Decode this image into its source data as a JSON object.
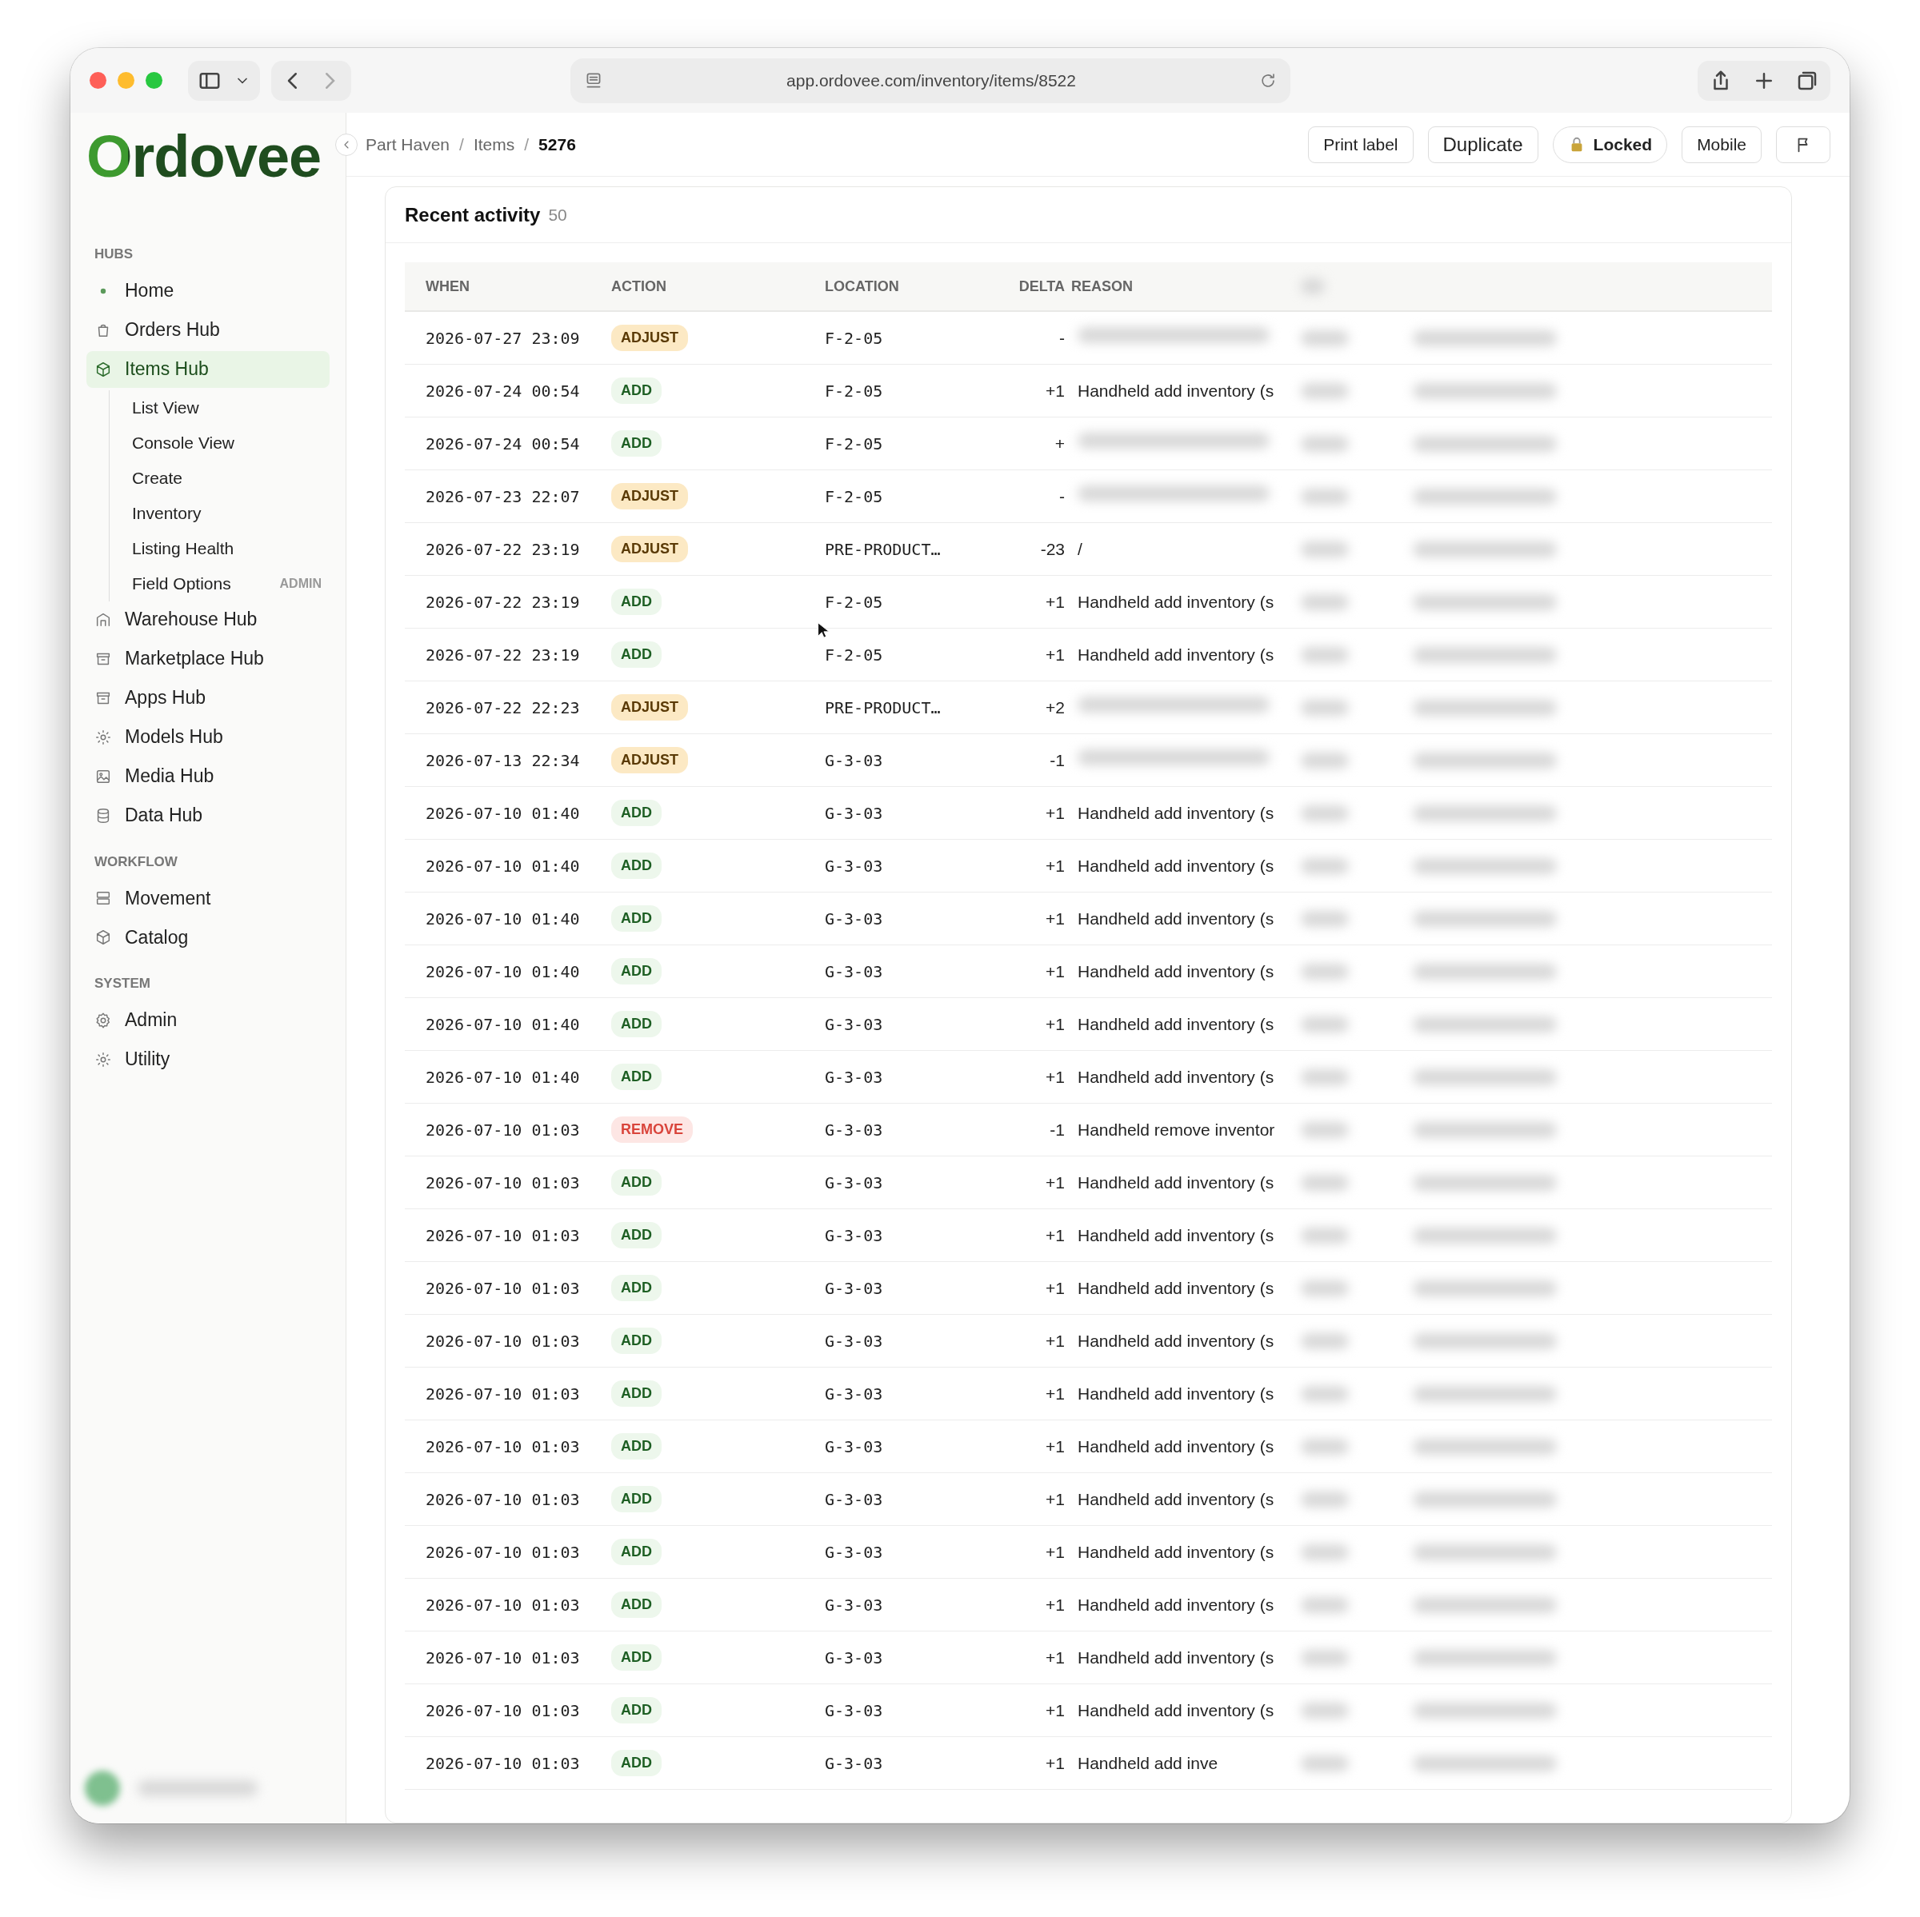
{
  "browser": {
    "url": "app.ordovee.com/inventory/items/8522"
  },
  "sidebar": {
    "logo": "Ordovee",
    "sections": [
      {
        "title": "HUBS",
        "items": [
          {
            "label": "Home",
            "selected": false
          },
          {
            "label": "Orders Hub",
            "selected": false
          },
          {
            "label": "Items Hub",
            "selected": true,
            "children": [
              {
                "label": "List View"
              },
              {
                "label": "Console View"
              },
              {
                "label": "Create"
              },
              {
                "label": "Inventory"
              },
              {
                "label": "Listing Health"
              },
              {
                "label": "Field Options",
                "tag": "ADMIN"
              }
            ]
          },
          {
            "label": "Warehouse Hub",
            "selected": false
          },
          {
            "label": "Marketplace Hub",
            "selected": false
          },
          {
            "label": "Apps Hub",
            "selected": false
          },
          {
            "label": "Models Hub",
            "selected": false
          },
          {
            "label": "Media Hub",
            "selected": false
          },
          {
            "label": "Data Hub",
            "selected": false
          }
        ]
      },
      {
        "title": "WORKFLOW",
        "items": [
          {
            "label": "Movement",
            "selected": false
          },
          {
            "label": "Catalog",
            "selected": false
          }
        ]
      },
      {
        "title": "SYSTEM",
        "items": [
          {
            "label": "Admin",
            "selected": false
          },
          {
            "label": "Utility",
            "selected": false
          }
        ]
      }
    ]
  },
  "breadcrumbs": [
    {
      "label": "Part Haven",
      "current": false
    },
    {
      "separator": "/",
      "label": "Items",
      "current": false
    },
    {
      "separator": "/",
      "label": "5276",
      "current": true
    }
  ],
  "actions": [
    {
      "kind": "text",
      "label": "Print label"
    },
    {
      "kind": "large",
      "label": "Duplicate"
    },
    {
      "kind": "lock",
      "label": "Locked"
    },
    {
      "kind": "text",
      "label": "Mobile"
    },
    {
      "kind": "flag"
    }
  ],
  "activity": {
    "title": "Recent activity",
    "count": "50",
    "columns": [
      "WHEN",
      "ACTION",
      "LOCATION",
      "DELTA",
      "REASON"
    ],
    "rows": [
      {
        "when": "2026-07-27 23:09",
        "action": "ADJUST",
        "kind": "adjust",
        "location": "F-2-05",
        "delta": "-"
      },
      {
        "when": "2026-07-24 00:54",
        "action": "ADD",
        "kind": "add",
        "location": "F-2-05",
        "delta": "+1",
        "reason": "Handheld add inventory (s"
      },
      {
        "when": "2026-07-24 00:54",
        "action": "ADD",
        "kind": "add",
        "location": "F-2-05",
        "delta": "+"
      },
      {
        "when": "2026-07-23 22:07",
        "action": "ADJUST",
        "kind": "adjust",
        "location": "F-2-05",
        "delta": "-"
      },
      {
        "when": "2026-07-22 23:19",
        "action": "ADJUST",
        "kind": "adjust",
        "location": "PRE-PRODUCT…",
        "delta": "-23",
        "reason": "/"
      },
      {
        "when": "2026-07-22 23:19",
        "action": "ADD",
        "kind": "add",
        "location": "F-2-05",
        "delta": "+1",
        "reason": "Handheld add inventory (s"
      },
      {
        "when": "2026-07-22 23:19",
        "action": "ADD",
        "kind": "add",
        "location": "F-2-05",
        "delta": "+1",
        "reason": "Handheld add inventory (s"
      },
      {
        "when": "2026-07-22 22:23",
        "action": "ADJUST",
        "kind": "adjust",
        "location": "PRE-PRODUCT…",
        "delta": "+2"
      },
      {
        "when": "2026-07-13 22:34",
        "action": "ADJUST",
        "kind": "adjust",
        "location": "G-3-03",
        "delta": "-1"
      },
      {
        "when": "2026-07-10 01:40",
        "action": "ADD",
        "kind": "add",
        "location": "G-3-03",
        "delta": "+1",
        "reason": "Handheld add inventory (s"
      },
      {
        "when": "2026-07-10 01:40",
        "action": "ADD",
        "kind": "add",
        "location": "G-3-03",
        "delta": "+1",
        "reason": "Handheld add inventory (s"
      },
      {
        "when": "2026-07-10 01:40",
        "action": "ADD",
        "kind": "add",
        "location": "G-3-03",
        "delta": "+1",
        "reason": "Handheld add inventory (s"
      },
      {
        "when": "2026-07-10 01:40",
        "action": "ADD",
        "kind": "add",
        "location": "G-3-03",
        "delta": "+1",
        "reason": "Handheld add inventory (s"
      },
      {
        "when": "2026-07-10 01:40",
        "action": "ADD",
        "kind": "add",
        "location": "G-3-03",
        "delta": "+1",
        "reason": "Handheld add inventory (s"
      },
      {
        "when": "2026-07-10 01:40",
        "action": "ADD",
        "kind": "add",
        "location": "G-3-03",
        "delta": "+1",
        "reason": "Handheld add inventory (s"
      },
      {
        "when": "2026-07-10 01:03",
        "action": "REMOVE",
        "kind": "remove",
        "location": "G-3-03",
        "delta": "-1",
        "reason": "Handheld remove inventor"
      },
      {
        "when": "2026-07-10 01:03",
        "action": "ADD",
        "kind": "add",
        "location": "G-3-03",
        "delta": "+1",
        "reason": "Handheld add inventory (s"
      },
      {
        "when": "2026-07-10 01:03",
        "action": "ADD",
        "kind": "add",
        "location": "G-3-03",
        "delta": "+1",
        "reason": "Handheld add inventory (s"
      },
      {
        "when": "2026-07-10 01:03",
        "action": "ADD",
        "kind": "add",
        "location": "G-3-03",
        "delta": "+1",
        "reason": "Handheld add inventory (s"
      },
      {
        "when": "2026-07-10 01:03",
        "action": "ADD",
        "kind": "add",
        "location": "G-3-03",
        "delta": "+1",
        "reason": "Handheld add inventory (s"
      },
      {
        "when": "2026-07-10 01:03",
        "action": "ADD",
        "kind": "add",
        "location": "G-3-03",
        "delta": "+1",
        "reason": "Handheld add inventory (s"
      },
      {
        "when": "2026-07-10 01:03",
        "action": "ADD",
        "kind": "add",
        "location": "G-3-03",
        "delta": "+1",
        "reason": "Handheld add inventory (s"
      },
      {
        "when": "2026-07-10 01:03",
        "action": "ADD",
        "kind": "add",
        "location": "G-3-03",
        "delta": "+1",
        "reason": "Handheld add inventory (s"
      },
      {
        "when": "2026-07-10 01:03",
        "action": "ADD",
        "kind": "add",
        "location": "G-3-03",
        "delta": "+1",
        "reason": "Handheld add inventory (s"
      },
      {
        "when": "2026-07-10 01:03",
        "action": "ADD",
        "kind": "add",
        "location": "G-3-03",
        "delta": "+1",
        "reason": "Handheld add inventory (s"
      },
      {
        "when": "2026-07-10 01:03",
        "action": "ADD",
        "kind": "add",
        "location": "G-3-03",
        "delta": "+1",
        "reason": "Handheld add inventory (s"
      },
      {
        "when": "2026-07-10 01:03",
        "action": "ADD",
        "kind": "add",
        "location": "G-3-03",
        "delta": "+1",
        "reason": "Handheld add inventory (s"
      },
      {
        "when": "2026-07-10 01:03",
        "action": "ADD",
        "kind": "add",
        "location": "G-3-03",
        "delta": "+1",
        "reason": "Handheld add inve"
      }
    ]
  }
}
